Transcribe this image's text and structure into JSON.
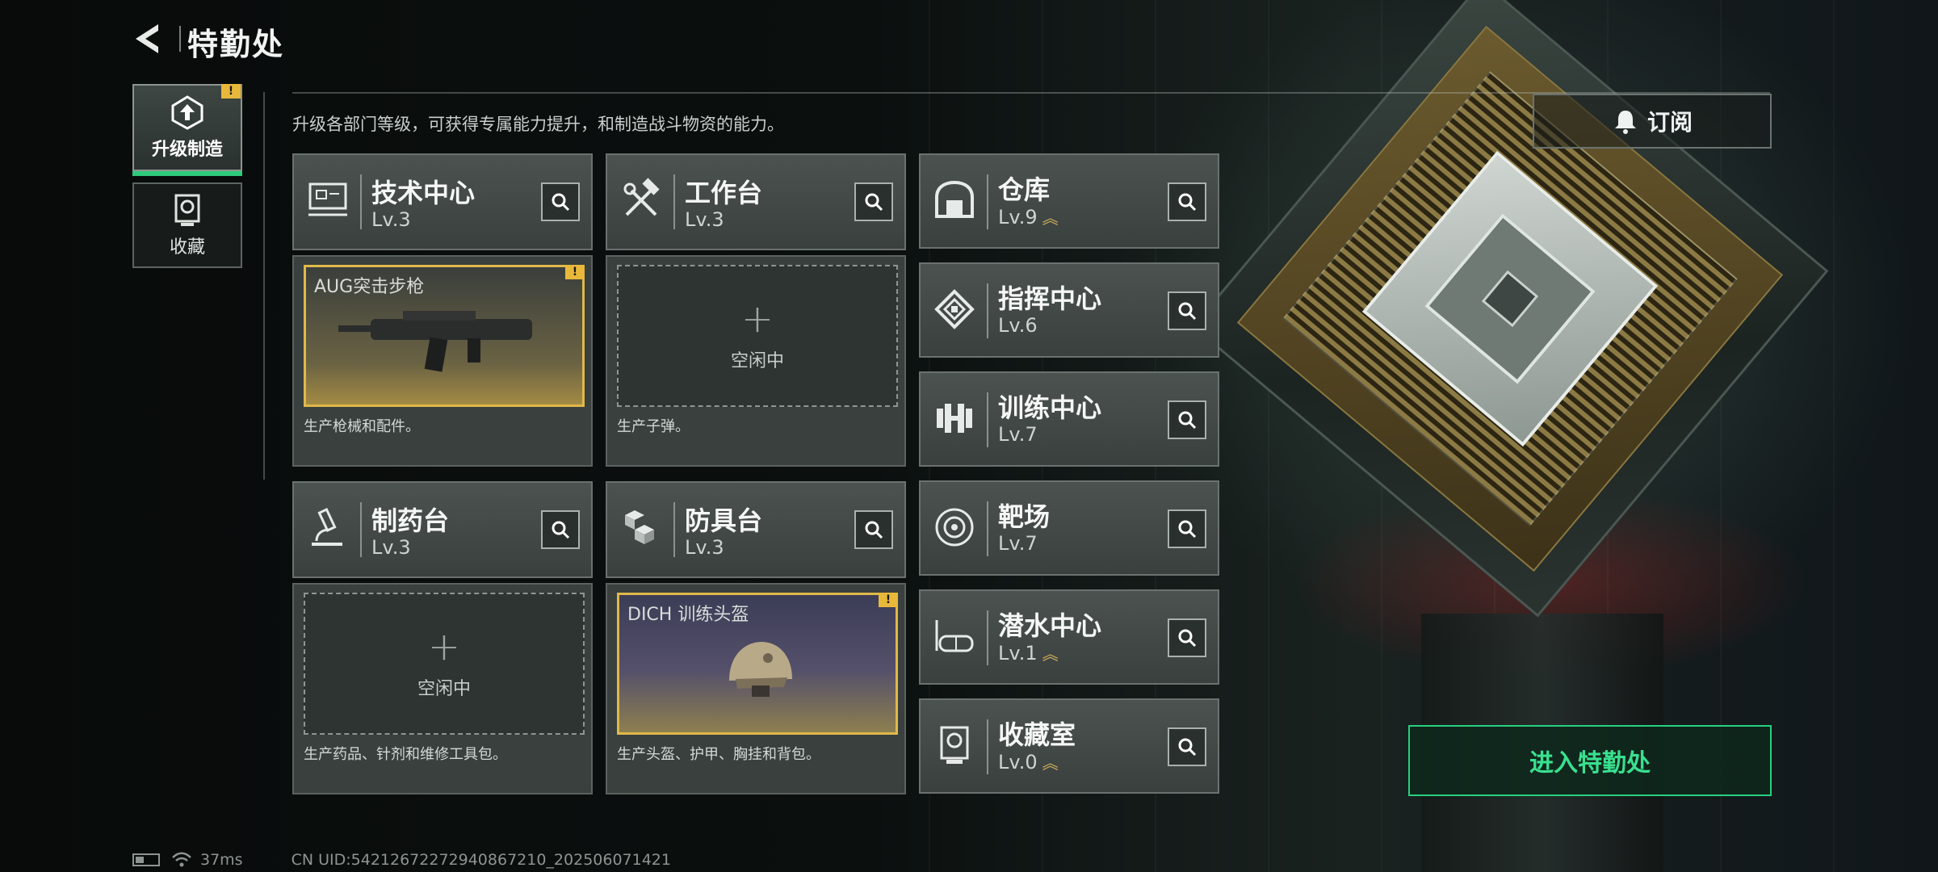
{
  "header": {
    "title": "特勤处"
  },
  "rail": {
    "upgrade_label": "升级制造",
    "collection_label": "收藏",
    "upgrade_badge": "!"
  },
  "description": "升级各部门等级，可获得专属能力提升，和制造战斗物资的能力。",
  "subscribe_label": "订阅",
  "departments": [
    {
      "name": "技术中心",
      "level": "Lv.3",
      "icon": "monitor-icon"
    },
    {
      "name": "工作台",
      "level": "Lv.3",
      "icon": "hammer-wrench-icon"
    },
    {
      "name": "制药台",
      "level": "Lv.3",
      "icon": "microscope-icon"
    },
    {
      "name": "防具台",
      "level": "Lv.3",
      "icon": "cubes-icon"
    },
    {
      "name": "仓库",
      "level": "Lv.9",
      "icon": "warehouse-icon",
      "upgradable": true
    },
    {
      "name": "指挥中心",
      "level": "Lv.6",
      "icon": "chip-icon"
    },
    {
      "name": "训练中心",
      "level": "Lv.7",
      "icon": "dumbbell-icon"
    },
    {
      "name": "靶场",
      "level": "Lv.7",
      "icon": "target-icon"
    },
    {
      "name": "潜水中心",
      "level": "Lv.1",
      "icon": "diving-mask-icon",
      "upgradable": true
    },
    {
      "name": "收藏室",
      "level": "Lv.0",
      "icon": "trophy-icon",
      "upgradable": true
    }
  ],
  "production": [
    {
      "item": "AUG突击步枪",
      "status": "filled",
      "desc": "生产枪械和配件。",
      "badge": "!"
    },
    {
      "item": "",
      "status": "idle",
      "idle_label": "空闲中",
      "desc": "生产子弹。"
    },
    {
      "item": "",
      "status": "idle",
      "idle_label": "空闲中",
      "desc": "生产药品、针剂和维修工具包。"
    },
    {
      "item": "DICH 训练头盔",
      "status": "filled",
      "desc": "生产头盔、护甲、胸挂和背包。",
      "badge": "!"
    }
  ],
  "enter_label": "进入特勤处",
  "footer": {
    "ping": "37ms",
    "uid": "CN UID:5421267227294086721​0_202506071421"
  },
  "colors": {
    "accent_green": "#2ec97a",
    "badge_yellow": "#e8b83a",
    "panel": "#4b5250"
  }
}
